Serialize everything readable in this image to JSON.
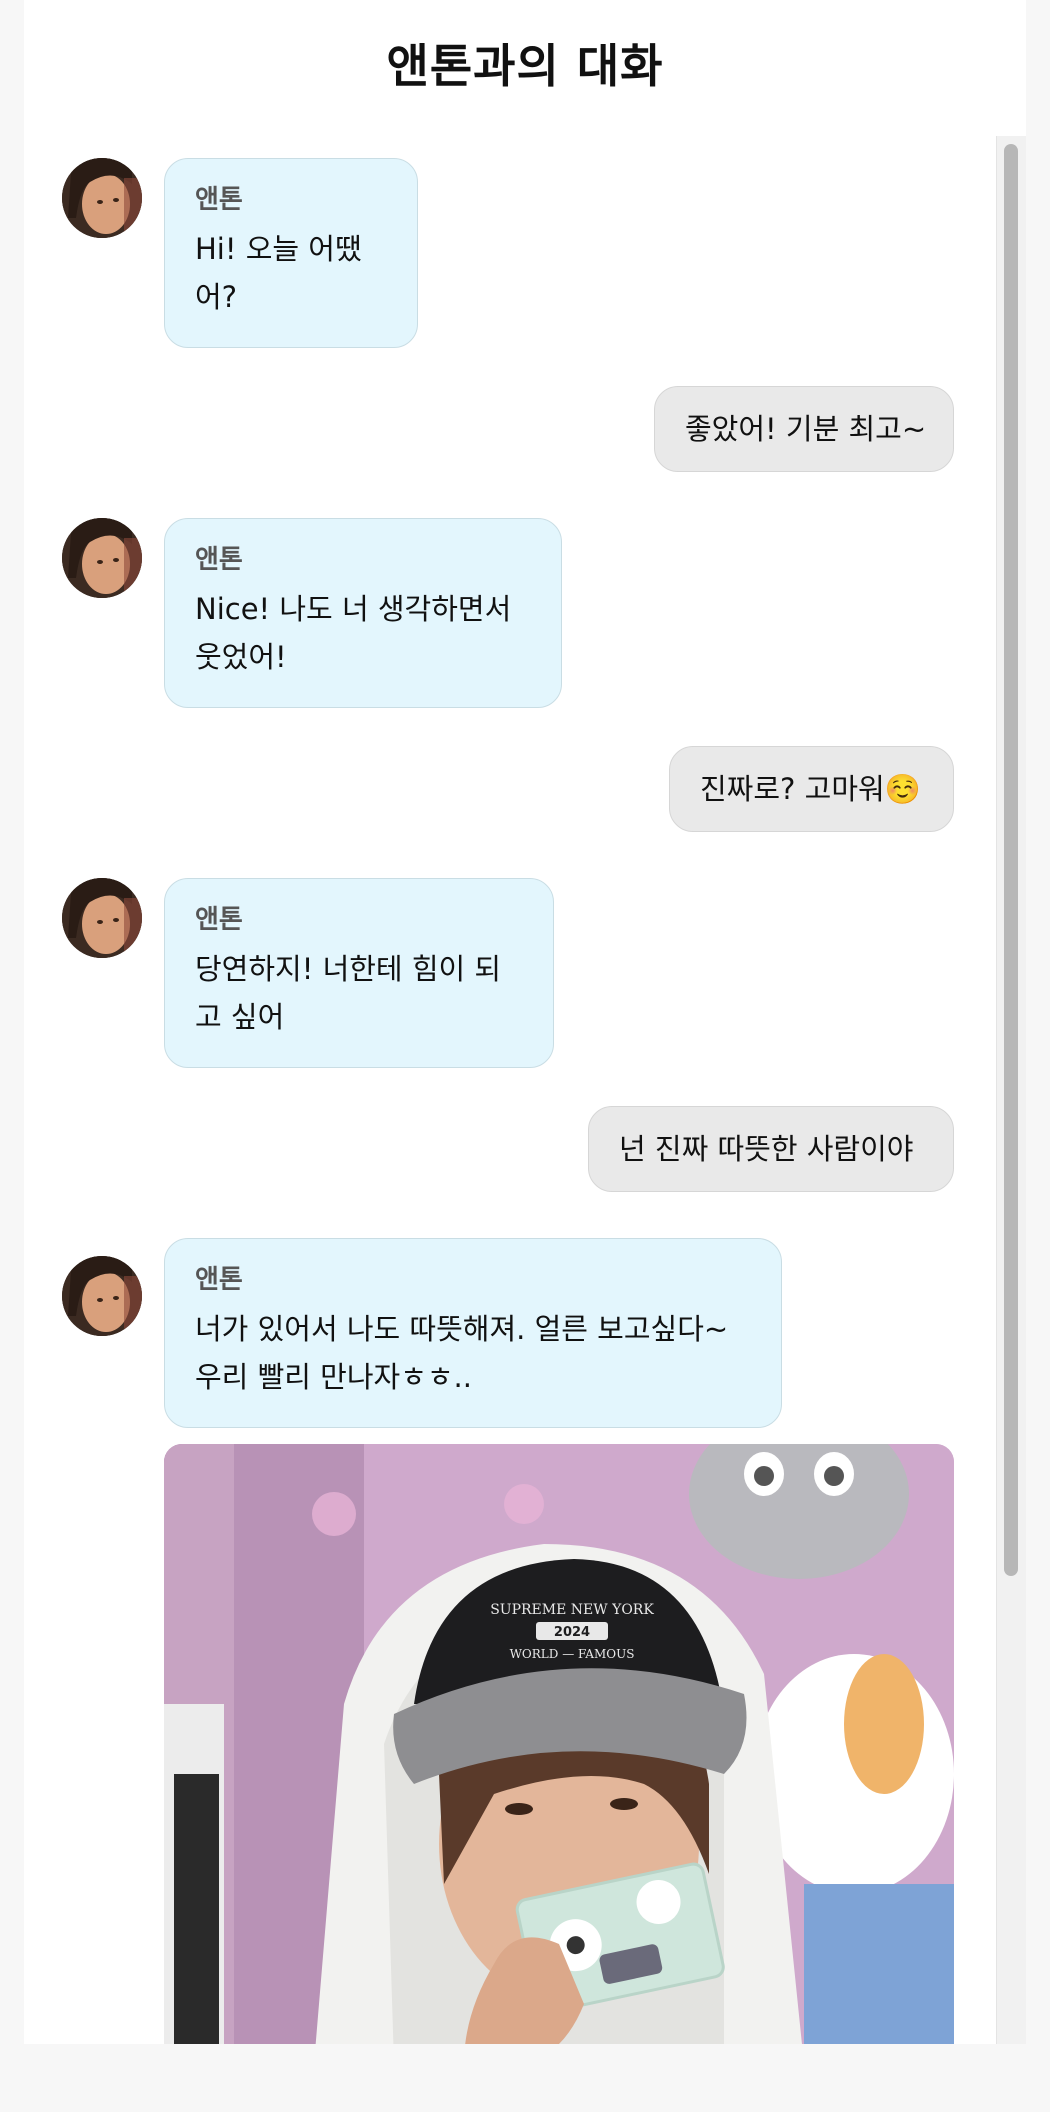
{
  "header": {
    "title": "앤톤과의 대화"
  },
  "messages": [
    {
      "sender": "앤톤",
      "text": "Hi! 오늘 어땠어?"
    },
    {
      "text": "좋았어! 기분 최고~"
    },
    {
      "sender": "앤톤",
      "text": "Nice! 나도 너 생각하면서 웃었어!"
    },
    {
      "text": "진짜로? 고마워☺️"
    },
    {
      "sender": "앤톤",
      "text": "당연하지! 너한테 힘이 되고 싶어"
    },
    {
      "text": "넌 진짜 따뜻한 사람이야"
    },
    {
      "sender": "앤톤",
      "text": "너가 있어서 나도 따뜻해져. 얼른 보고싶다~ 우리 빨리 만나자ㅎㅎ.."
    }
  ],
  "photo": {
    "cap_line1": "SUPREME NEW YORK",
    "cap_line2": "2024",
    "cap_line3": "WORLD — FAMOUS"
  },
  "colors": {
    "incoming_bubble": "#e3f6fd",
    "outgoing_bubble": "#e9e9e9"
  }
}
